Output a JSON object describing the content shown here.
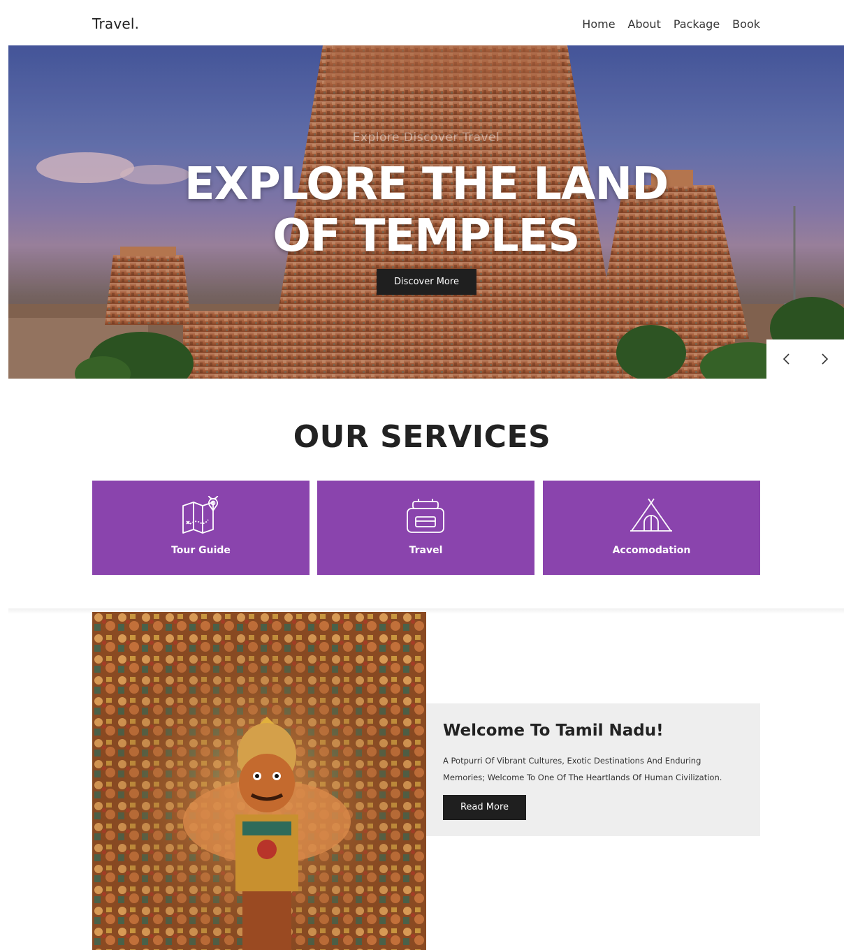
{
  "header": {
    "logo": "Travel.",
    "nav": [
      "Home",
      "About",
      "Package",
      "Book"
    ]
  },
  "hero": {
    "subtitle": "Explore Discover Travel",
    "title_line1": "EXPLORE THE LAND",
    "title_line2": "OF TEMPLES",
    "button": "Discover More",
    "prev_icon": "chevron-left-icon",
    "next_icon": "chevron-right-icon"
  },
  "services": {
    "title": "OUR SERVICES",
    "accent_color": "#8a44ad",
    "items": [
      {
        "label": "Tour Guide",
        "icon": "map-pin-icon"
      },
      {
        "label": "Travel",
        "icon": "backpack-icon"
      },
      {
        "label": "Accomodation",
        "icon": "tent-icon"
      }
    ]
  },
  "welcome": {
    "title": "Welcome To Tamil Nadu!",
    "text": "A Potpurri Of Vibrant Cultures, Exotic Destinations And Enduring Memories; Welcome To One Of The Heartlands Of Human Civilization.",
    "button": "Read More"
  }
}
